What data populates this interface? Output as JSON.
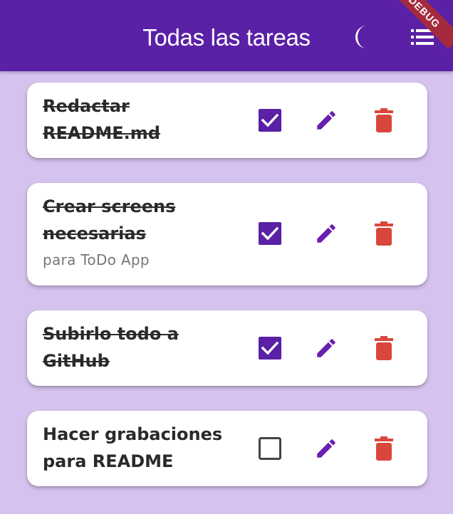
{
  "app_bar": {
    "title": "Todas las tareas",
    "debug_banner": "DEBUG",
    "theme_icon": "moon-icon",
    "menu_icon": "list-icon"
  },
  "colors": {
    "app_bar": "#5A20A6",
    "background": "#D6C2EE",
    "checkbox": "#5A20A6",
    "edit_icon": "#6A1FB0",
    "delete_icon": "#D9473C"
  },
  "tasks": [
    {
      "title": "Redactar README.md",
      "subtitle": "",
      "done": true
    },
    {
      "title": "Crear screens necesarias",
      "subtitle": "para ToDo App",
      "done": true
    },
    {
      "title": "Subirlo todo a GitHub",
      "subtitle": "",
      "done": true
    },
    {
      "title": "Hacer grabaciones para README",
      "subtitle": "",
      "done": false
    }
  ]
}
